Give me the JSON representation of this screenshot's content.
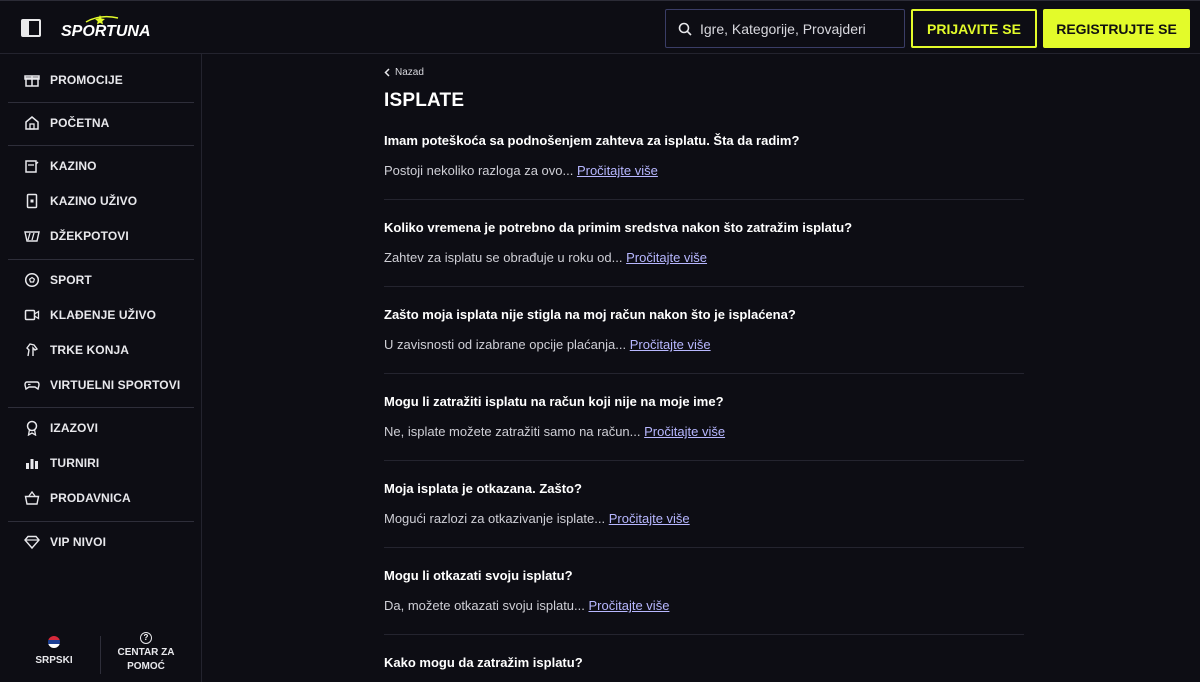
{
  "header": {
    "brand": "SPORTUNA",
    "search_placeholder": "Igre, Kategorije, Provajderi",
    "login_label": "PRIJAVITE SE",
    "register_label": "REGISTRUJTE SE",
    "accent_color": "#e3fb2a"
  },
  "sidebar": {
    "items": [
      {
        "label": "PROMOCIJE",
        "icon": "gift-icon"
      },
      {
        "label": "POČETNA",
        "icon": "home-icon"
      },
      {
        "label": "KAZINO",
        "icon": "slot-machine-icon"
      },
      {
        "label": "KAZINO UŽIVO",
        "icon": "card-icon"
      },
      {
        "label": "DŽEKPOTOVI",
        "icon": "jackpot-icon"
      },
      {
        "label": "SPORT",
        "icon": "ball-icon"
      },
      {
        "label": "KLAĐENJE UŽIVO",
        "icon": "live-video-icon"
      },
      {
        "label": "TRKE KONJA",
        "icon": "horse-icon"
      },
      {
        "label": "VIRTUELNI SPORTOVI",
        "icon": "gamepad-icon"
      },
      {
        "label": "IZAZOVI",
        "icon": "badge-icon"
      },
      {
        "label": "TURNIRI",
        "icon": "trophy-icon"
      },
      {
        "label": "PRODAVNICA",
        "icon": "basket-icon"
      },
      {
        "label": "VIP NIVOI",
        "icon": "diamond-icon"
      }
    ],
    "footer": {
      "language": "SRPSKI",
      "help_line1": "CENTAR ZA",
      "help_line2": "POMOĆ"
    }
  },
  "main": {
    "back_label": "Nazad",
    "title": "ISPLATE",
    "read_more": "Pročitajte više",
    "faqs": [
      {
        "question": "Imam poteškoća sa podnošenjem zahteva za isplatu. Šta da radim?",
        "answer": "Postoji nekoliko razloga za ovo..."
      },
      {
        "question": "Koliko vremena je potrebno da primim sredstva nakon što zatražim isplatu?",
        "answer": "Zahtev za isplatu se obrađuje u roku od..."
      },
      {
        "question": "Zašto moja isplata nije stigla na moj račun nakon što je isplaćena?",
        "answer": "U zavisnosti od izabrane opcije plaćanja..."
      },
      {
        "question": "Mogu li zatražiti isplatu na račun koji nije na moje ime?",
        "answer": "Ne, isplate možete zatražiti samo na račun..."
      },
      {
        "question": "Moja isplata je otkazana. Zašto?",
        "answer": "Mogući razlozi za otkazivanje isplate..."
      },
      {
        "question": "Mogu li otkazati svoju isplatu?",
        "answer": "Da, možete otkazati svoju isplatu..."
      },
      {
        "question": "Kako mogu da zatražim isplatu?",
        "answer": ""
      }
    ]
  }
}
